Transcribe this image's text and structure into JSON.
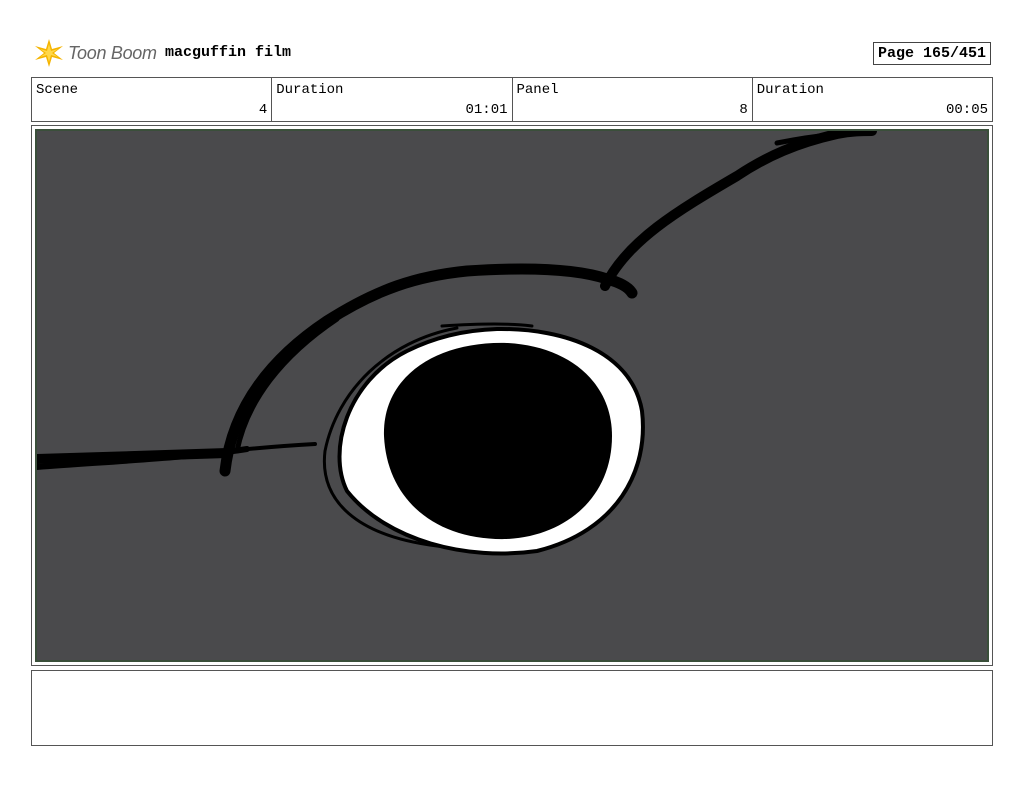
{
  "header": {
    "logo_text": "Toon Boom",
    "project_title": "macguffin film",
    "page_label": "Page 165/451"
  },
  "info": {
    "scene_label": "Scene",
    "scene_value": "4",
    "scene_duration_label": "Duration",
    "scene_duration_value": "01:01",
    "panel_label": "Panel",
    "panel_value": "8",
    "panel_duration_label": "Duration",
    "panel_duration_value": "00:05"
  },
  "panel": {
    "background_color": "#4a4a4c",
    "frame_color": "#3a4f3a"
  },
  "notes": {
    "text": ""
  }
}
